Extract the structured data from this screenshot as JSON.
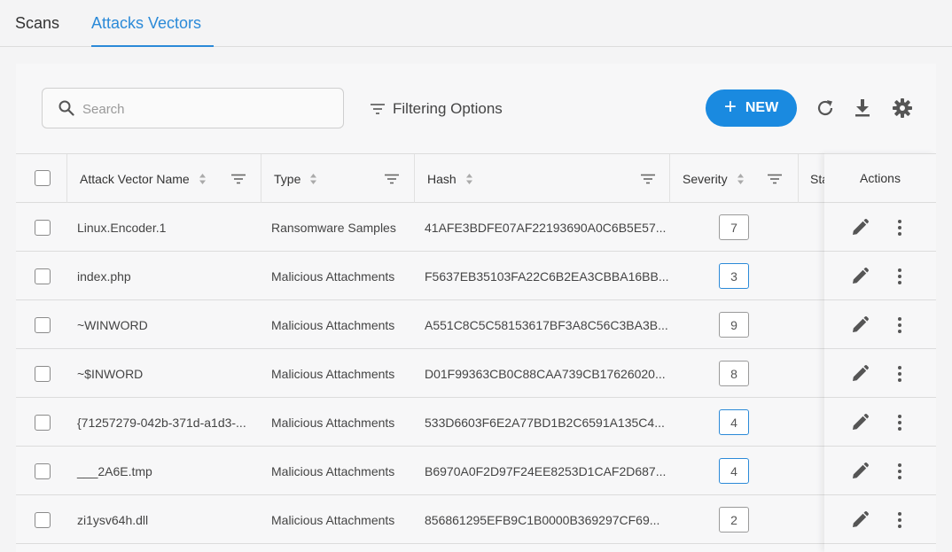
{
  "tabs": [
    {
      "label": "Scans",
      "active": false
    },
    {
      "label": "Attacks Vectors",
      "active": true
    }
  ],
  "toolbar": {
    "search_placeholder": "Search",
    "search_value": "",
    "filter_label": "Filtering Options",
    "new_label": "NEW"
  },
  "table": {
    "columns": {
      "name": "Attack Vector Name",
      "type": "Type",
      "hash": "Hash",
      "severity": "Severity",
      "status": "Sta",
      "actions": "Actions"
    },
    "rows": [
      {
        "name": "Linux.Encoder.1",
        "type": "Ransomware Samples",
        "hash": "41AFE3BDFE07AF22193690A0C6B5E57...",
        "severity": "7"
      },
      {
        "name": "index.php",
        "type": "Malicious Attachments",
        "hash": "F5637EB35103FA22C6B2EA3CBBA16BB...",
        "severity": "3"
      },
      {
        "name": "~WINWORD",
        "type": "Malicious Attachments",
        "hash": "A551C8C5C58153617BF3A8C56C3BA3B...",
        "severity": "9"
      },
      {
        "name": "~$INWORD",
        "type": "Malicious Attachments",
        "hash": "D01F99363CB0C88CAA739CB17626020...",
        "severity": "8"
      },
      {
        "name": "{71257279-042b-371d-a1d3-...",
        "type": "Malicious Attachments",
        "hash": "533D6603F6E2A77BD1B2C6591A135C4...",
        "severity": "4"
      },
      {
        "name": "___2A6E.tmp",
        "type": "Malicious Attachments",
        "hash": "B6970A0F2D97F24EE8253D1CAF2D687...",
        "severity": "4"
      },
      {
        "name": "zi1ysv64h.dll",
        "type": "Malicious Attachments",
        "hash": "856861295EFB9C1B0000B369297CF69...",
        "severity": "2"
      }
    ]
  },
  "colors": {
    "accent": "#1a8ae0",
    "severity_blue": "#2b8ad8",
    "severity_gray": "#9a9a9a"
  },
  "icons": [
    "search-icon",
    "filter-icon",
    "plus-icon",
    "refresh-icon",
    "download-icon",
    "gear-icon",
    "sort-icon",
    "column-filter-icon",
    "pencil-icon",
    "kebab-icon",
    "mouse-cursor-icon"
  ]
}
